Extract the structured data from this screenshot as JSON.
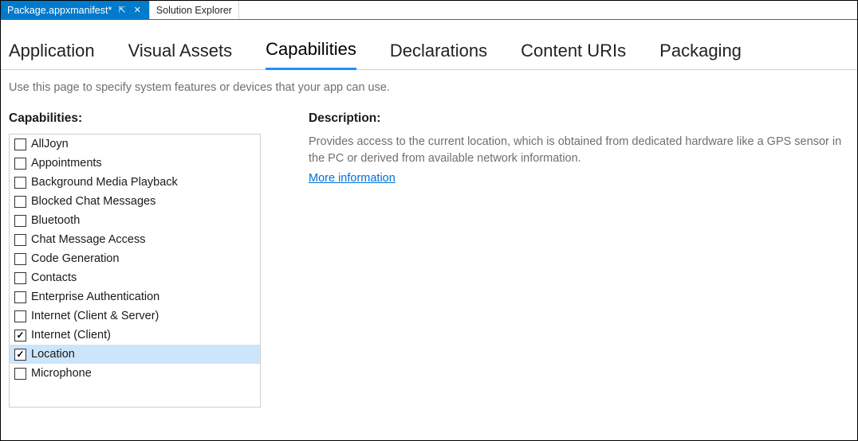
{
  "doc_tabs": {
    "active": {
      "label": "Package.appxmanifest*",
      "pin_glyph": "⇱",
      "close_glyph": "✕"
    },
    "inactive": {
      "label": "Solution Explorer"
    }
  },
  "nav_tabs": [
    {
      "label": "Application",
      "selected": false
    },
    {
      "label": "Visual Assets",
      "selected": false
    },
    {
      "label": "Capabilities",
      "selected": true
    },
    {
      "label": "Declarations",
      "selected": false
    },
    {
      "label": "Content URIs",
      "selected": false
    },
    {
      "label": "Packaging",
      "selected": false
    }
  ],
  "hint": "Use this page to specify system features or devices that your app can use.",
  "left": {
    "title": "Capabilities:",
    "items": [
      {
        "label": "AllJoyn",
        "checked": false,
        "selected": false
      },
      {
        "label": "Appointments",
        "checked": false,
        "selected": false
      },
      {
        "label": "Background Media Playback",
        "checked": false,
        "selected": false
      },
      {
        "label": "Blocked Chat Messages",
        "checked": false,
        "selected": false
      },
      {
        "label": "Bluetooth",
        "checked": false,
        "selected": false
      },
      {
        "label": "Chat Message Access",
        "checked": false,
        "selected": false
      },
      {
        "label": "Code Generation",
        "checked": false,
        "selected": false
      },
      {
        "label": "Contacts",
        "checked": false,
        "selected": false
      },
      {
        "label": "Enterprise Authentication",
        "checked": false,
        "selected": false
      },
      {
        "label": "Internet (Client & Server)",
        "checked": false,
        "selected": false
      },
      {
        "label": "Internet (Client)",
        "checked": true,
        "selected": false
      },
      {
        "label": "Location",
        "checked": true,
        "selected": true
      },
      {
        "label": "Microphone",
        "checked": false,
        "selected": false
      }
    ]
  },
  "right": {
    "title": "Description:",
    "text": "Provides access to the current location, which is obtained from dedicated hardware like a GPS sensor in the PC or derived from available network information.",
    "more": "More information"
  }
}
